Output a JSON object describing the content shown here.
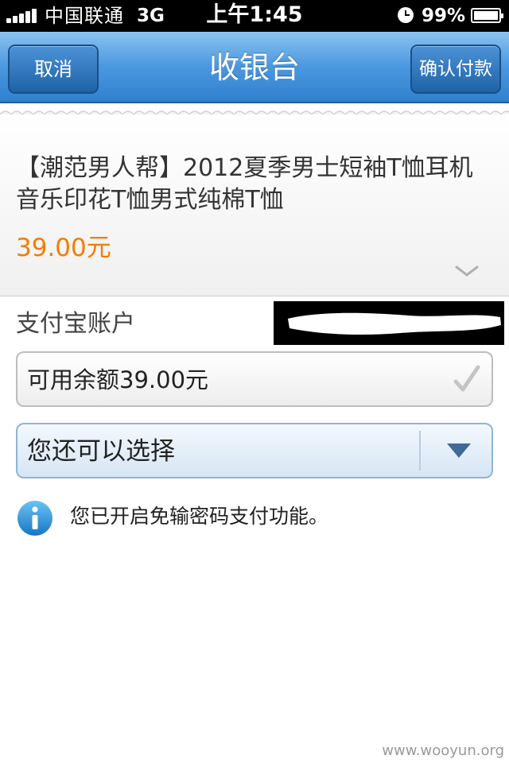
{
  "status_bar": {
    "carrier": "中国联通",
    "network": "3G",
    "time": "上午1:45",
    "battery": "99%",
    "battery_level": 0.99
  },
  "nav": {
    "cancel_label": "取消",
    "title": "收银台",
    "confirm_label": "确认付款"
  },
  "product": {
    "title": "【潮范男人帮】2012夏季男士短袖T恤耳机音乐印花T恤男式纯棉T恤",
    "price": "39.00元"
  },
  "account": {
    "label": "支付宝账户"
  },
  "balance": {
    "text": "可用余额39.00元",
    "checked": true
  },
  "select": {
    "value": "您还可以选择"
  },
  "info": {
    "text": "您已开启免输密码支付功能。"
  },
  "watermark": "www.wooyun.org",
  "colors": {
    "nav_blue": "#3a8ad8",
    "price_orange": "#f57c00",
    "info_blue": "#1e8fd6"
  },
  "icons": {
    "expand": "chevron-down-icon",
    "balance": "check-icon",
    "select": "triangle-down-icon",
    "info": "info-icon"
  }
}
